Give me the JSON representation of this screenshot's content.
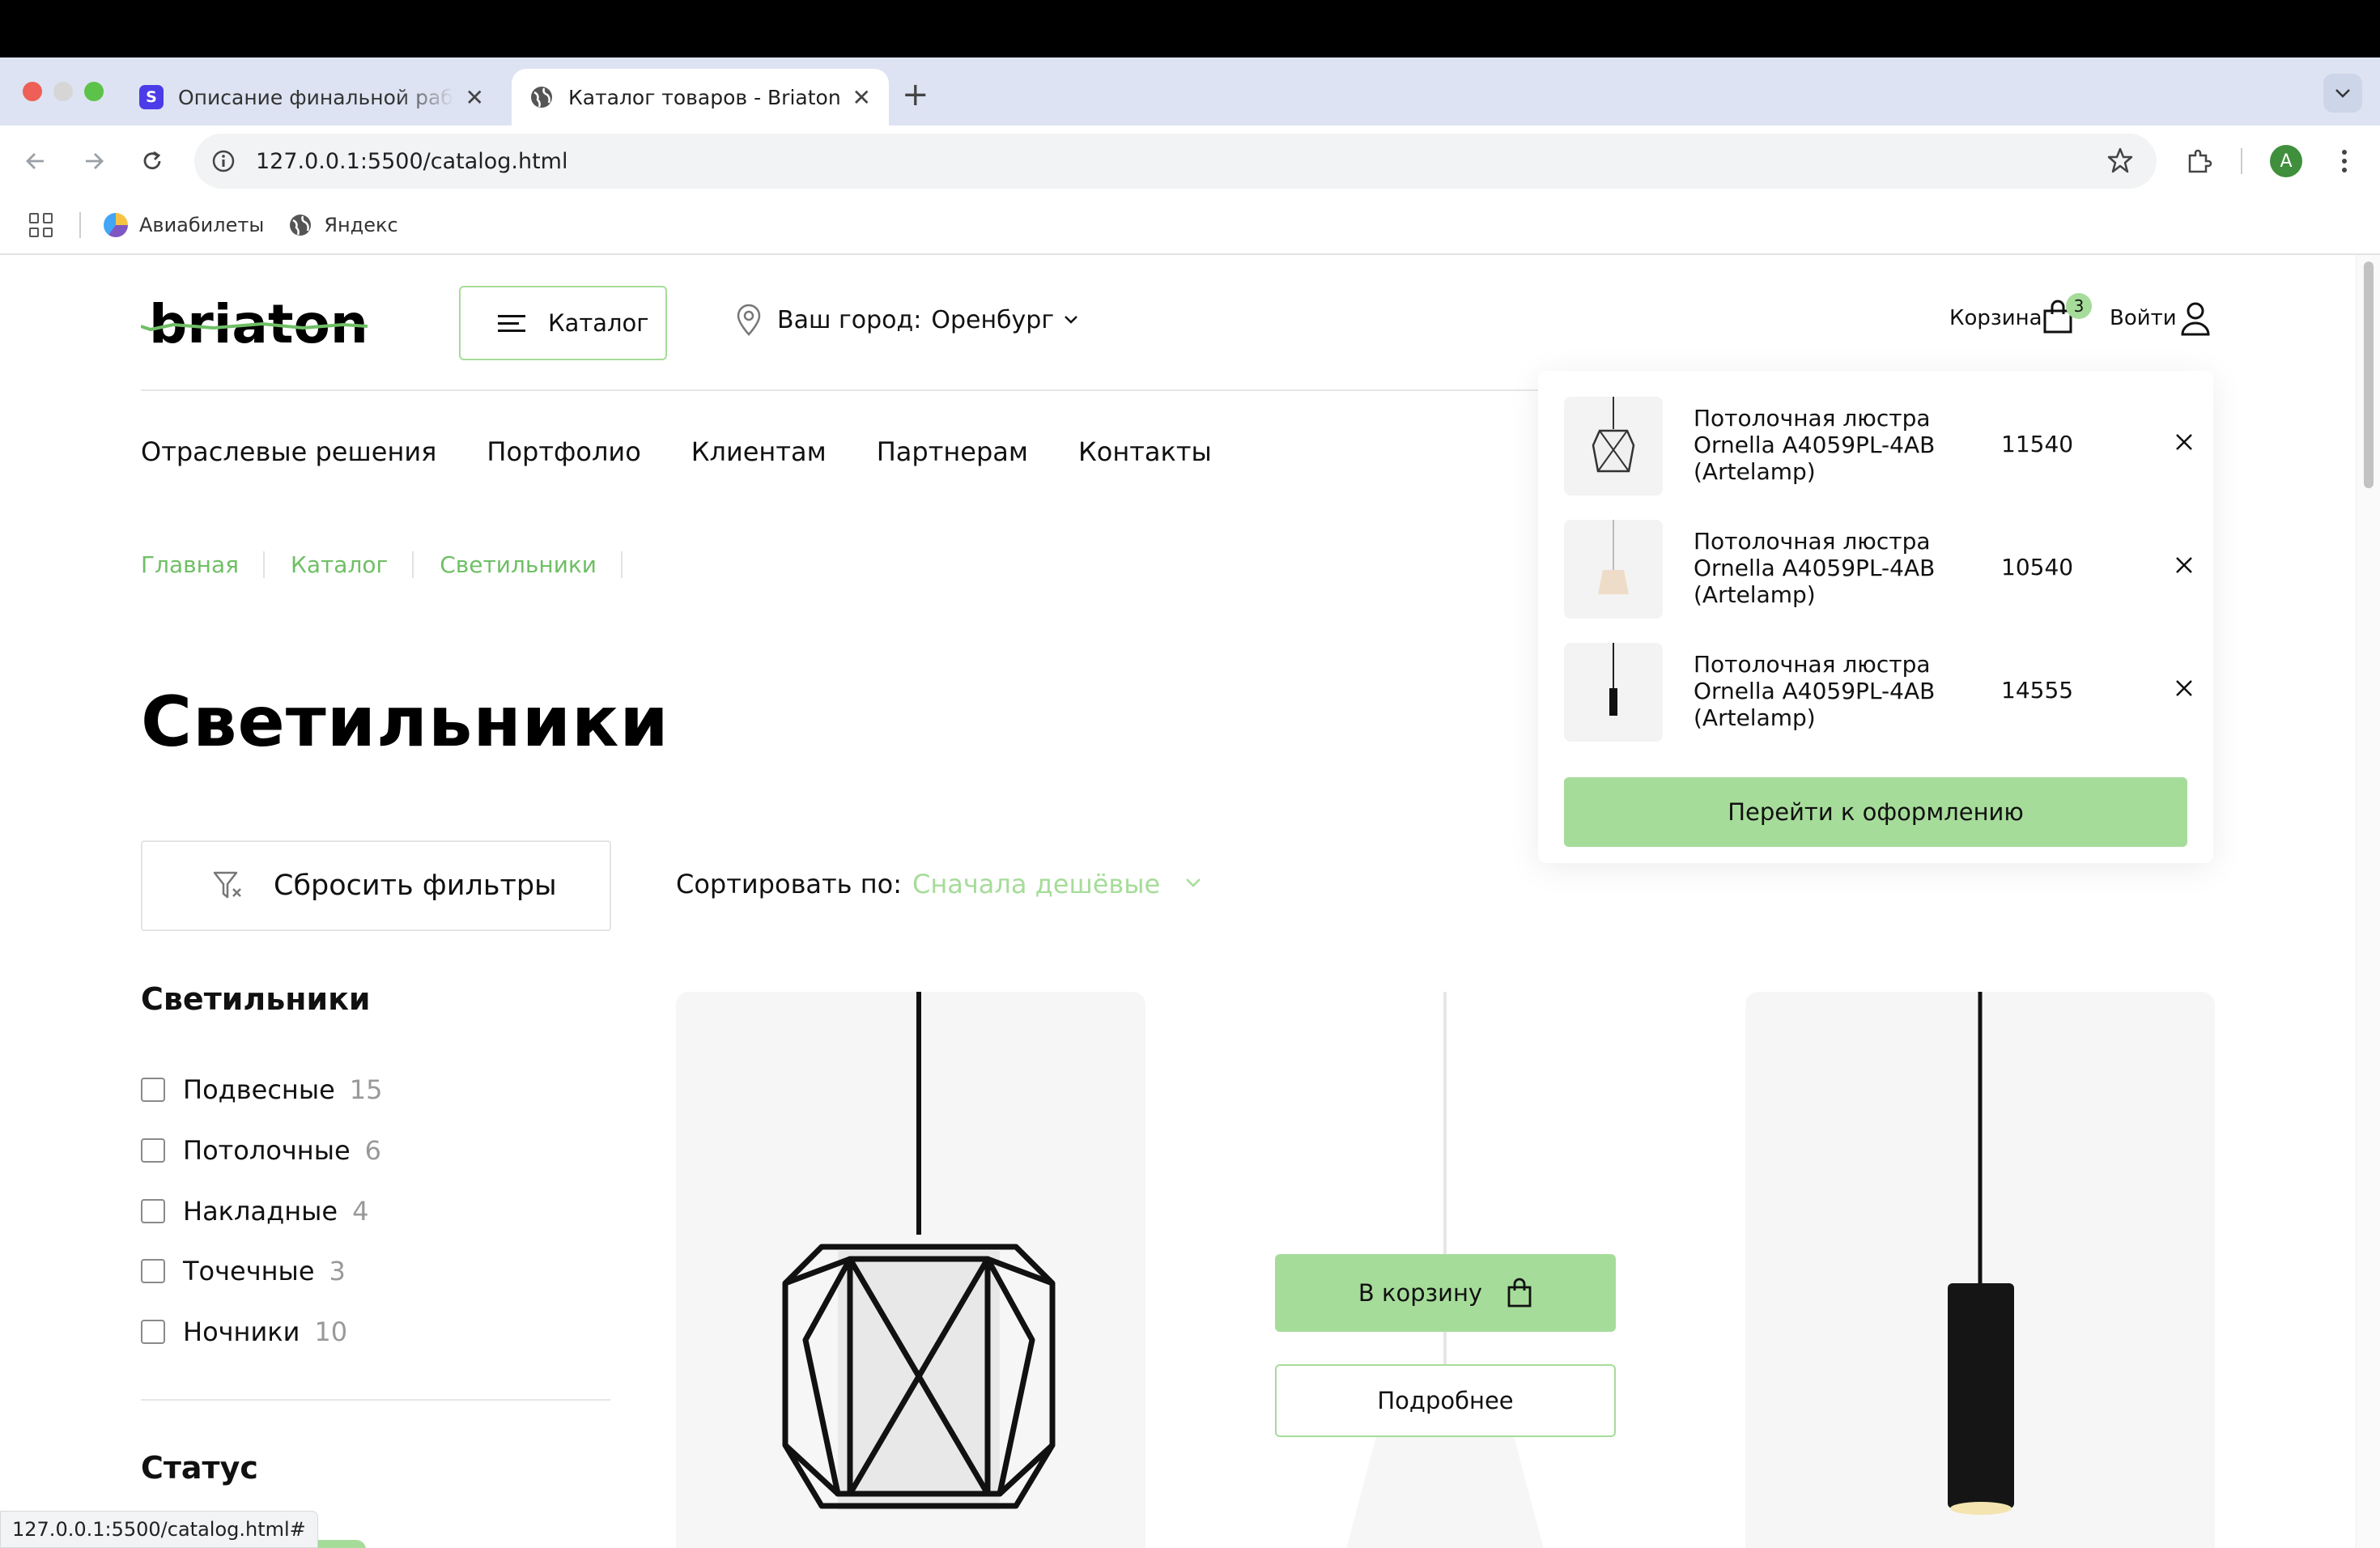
{
  "browser": {
    "tabs": [
      {
        "title": "Описание финальной работы",
        "favicon": "S",
        "active": false
      },
      {
        "title": "Каталог товаров - Briaton",
        "active": true
      }
    ],
    "url": "127.0.0.1:5500/catalog.html",
    "profile_initial": "A",
    "bookmarks": [
      "Авиабилеты",
      "Яндекс"
    ],
    "status_url": "127.0.0.1:5500/catalog.html#"
  },
  "header": {
    "logo": "briaton",
    "catalog_button": "Каталог",
    "city_label": "Ваш город:",
    "city_value": "Оренбург",
    "cart_label": "Корзина",
    "cart_count": "3",
    "login_label": "Войти"
  },
  "nav": [
    "Отраслевые решения",
    "Портфолио",
    "Клиентам",
    "Партнерам",
    "Контакты"
  ],
  "breadcrumbs": [
    "Главная",
    "Каталог",
    "Светильники"
  ],
  "page_title": "Светильники",
  "toolbar": {
    "reset_filters": "Сбросить фильтры",
    "sort_label": "Сортировать по:",
    "sort_value": "Сначала дешёвые"
  },
  "sidebar": {
    "types_title": "Светильники",
    "types": [
      {
        "label": "Подвесные",
        "count": "15"
      },
      {
        "label": "Потолочные",
        "count": "6"
      },
      {
        "label": "Накладные",
        "count": "4"
      },
      {
        "label": "Точечные",
        "count": "3"
      },
      {
        "label": "Ночники",
        "count": "10"
      }
    ],
    "status_title": "Статус"
  },
  "product_card": {
    "to_cart": "В корзину",
    "details": "Подробнее"
  },
  "cart_dropdown": {
    "items": [
      {
        "name": "Потолочная люстра Ornella A4059PL-4AB (Artelamp)",
        "price": "11540"
      },
      {
        "name": "Потолочная люстра Ornella A4059PL-4AB (Artelamp)",
        "price": "10540"
      },
      {
        "name": "Потолочная люстра Ornella A4059PL-4AB (Artelamp)",
        "price": "14555"
      }
    ],
    "checkout": "Перейти к оформлению"
  },
  "colors": {
    "accent": "#a6dc9a",
    "accent_text": "#6fbf65",
    "text": "#111111"
  }
}
